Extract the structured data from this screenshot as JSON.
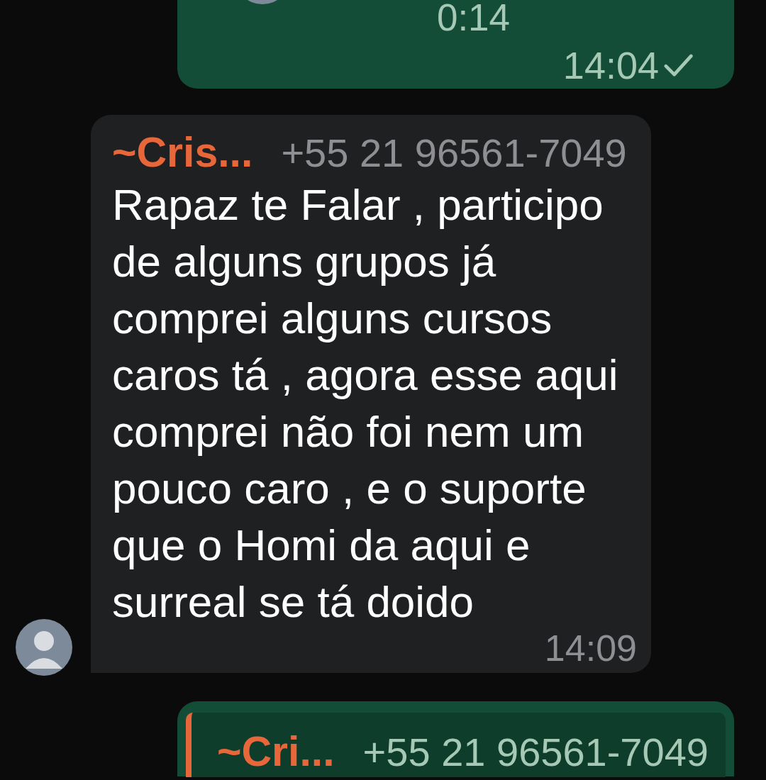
{
  "messages": [
    {
      "kind": "outgoing_voice",
      "duration": "0:14",
      "time": "14:04",
      "read": false
    },
    {
      "kind": "incoming",
      "sender": "~Cris...",
      "phone": "+55 21 96561-7049",
      "text": "Rapaz te Falar , participo de alguns grupos já comprei alguns cursos caros tá , agora esse aqui comprei não foi nem um pouco caro , e o suporte que o Homi da aqui e surreal se tá doido",
      "time": "14:09"
    },
    {
      "kind": "outgoing_reply",
      "quote": {
        "sender": "~Cri...",
        "phone": "+55 21 96561-7049"
      }
    }
  ]
}
